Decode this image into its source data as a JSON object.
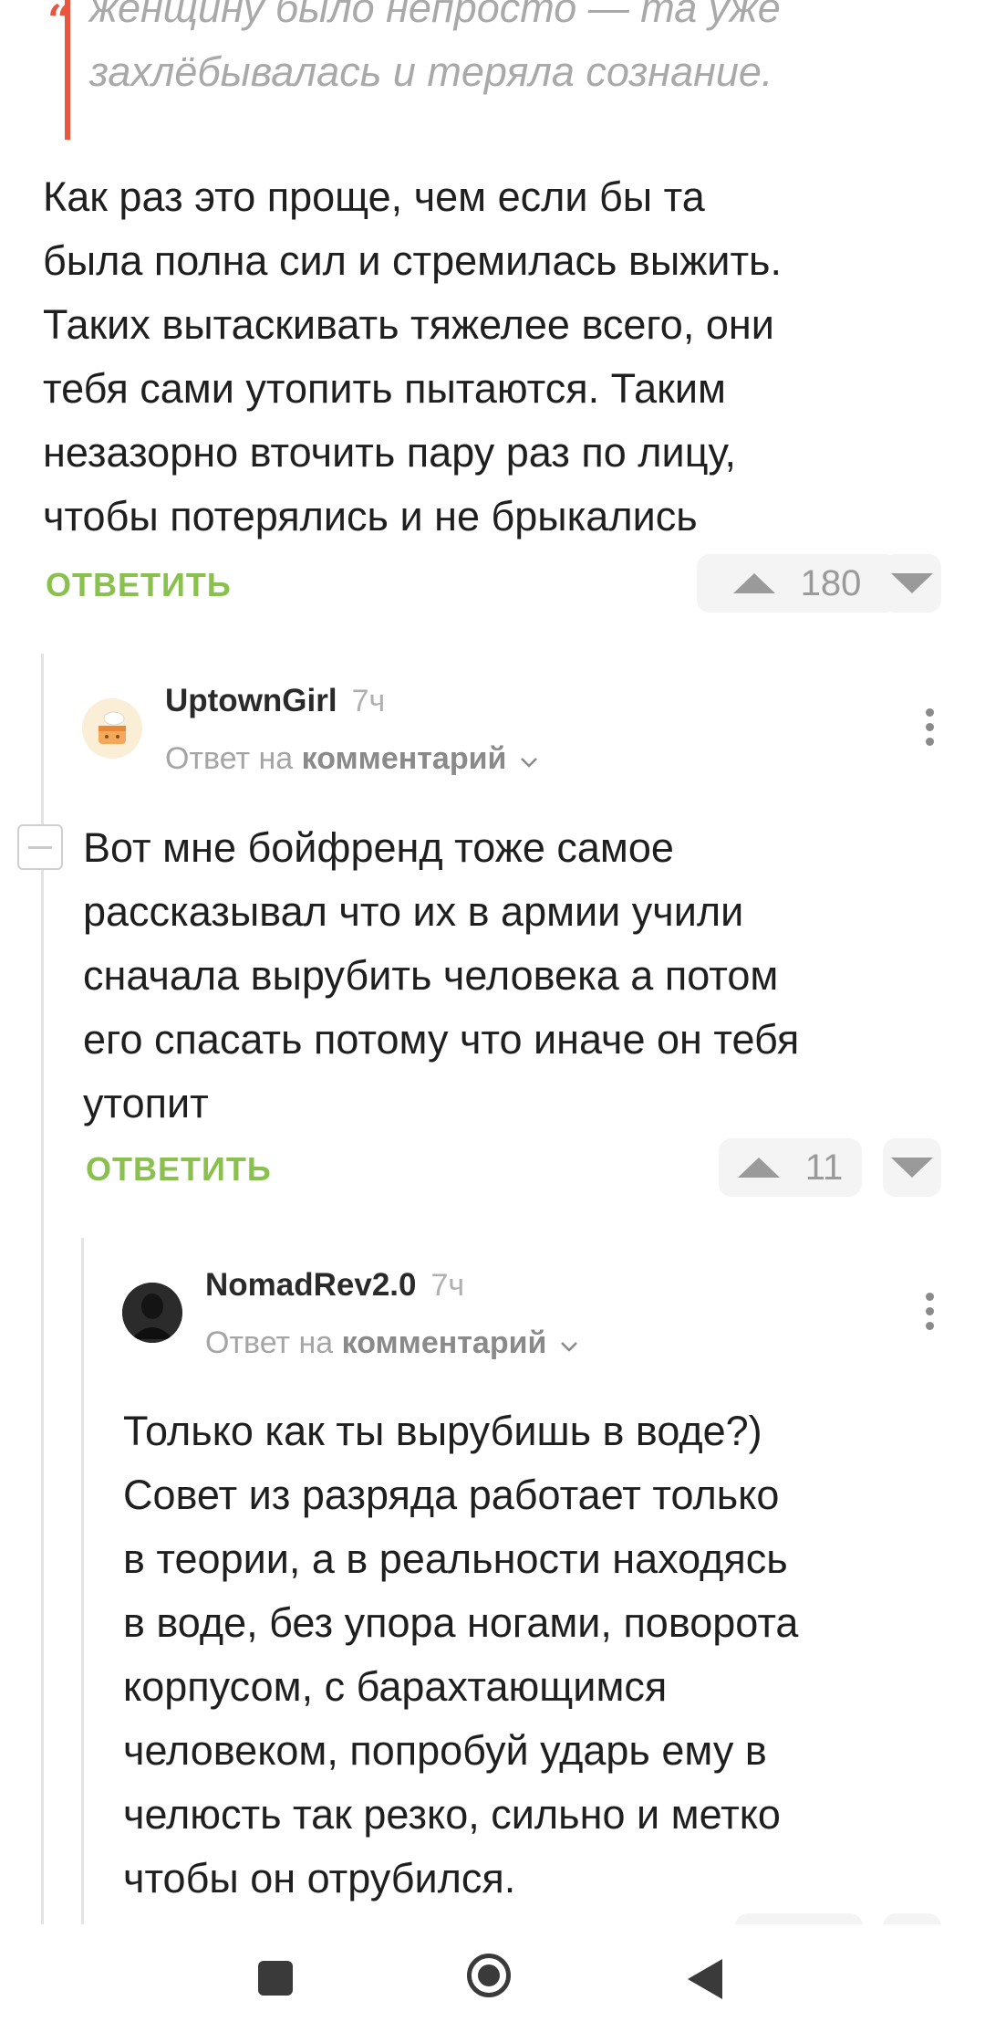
{
  "quote": {
    "text": "женщину было непросто — та уже\nзахлёбывалась и теряла сознание."
  },
  "comment_main": {
    "text": "Как раз это проще, чем если бы та\nбыла полна сил и стремилась выжить.\nТаких вытаскивать тяжелее всего, они\nтебя сами утопить пытаются. Таким\nнезазорно вточить пару раз по лицу,\nчтобы потерялись и не брыкались",
    "reply_label": "ОТВЕТИТЬ",
    "rating": "180"
  },
  "comment_uptown": {
    "username": "UptownGirl",
    "time": "7ч",
    "reply_prefix": "Ответ на",
    "reply_target": "комментарий",
    "text": "Вот мне бойфренд тоже самое\nрассказывал что их в армии учили\nсначала вырубить человека а потом\nего спасать потому что иначе он тебя\nутопит",
    "reply_label": "ОТВЕТИТЬ",
    "rating": "11"
  },
  "comment_nomad": {
    "username": "NomadRev2.0",
    "time": "7ч",
    "reply_prefix": "Ответ на",
    "reply_target": "комментарий",
    "text": "Только как ты вырубишь в воде?)\nСовет из разряда работает только\nв теории, а в реальности находясь\nв воде, без упора ногами, поворота\nкорпусом, с барахтающимся\nчеловеком, попробуй ударь ему в\nчелюсть так резко, сильно и метко\nчтобы он отрубился."
  },
  "icons": {
    "quote": "quote-icon",
    "upvote": "upvote-arrow-icon",
    "downvote": "downvote-arrow-icon",
    "more": "more-vertical-icon",
    "collapse": "collapse-thread-icon",
    "chevron": "chevron-down-icon",
    "nav_recent": "square-recents-icon",
    "nav_home": "circle-home-icon",
    "nav_back": "triangle-back-icon"
  },
  "colors": {
    "accent_green": "#8ac04e",
    "quote_red": "#e8563f",
    "text": "#1f1f1f",
    "muted": "#a5a5a5"
  }
}
